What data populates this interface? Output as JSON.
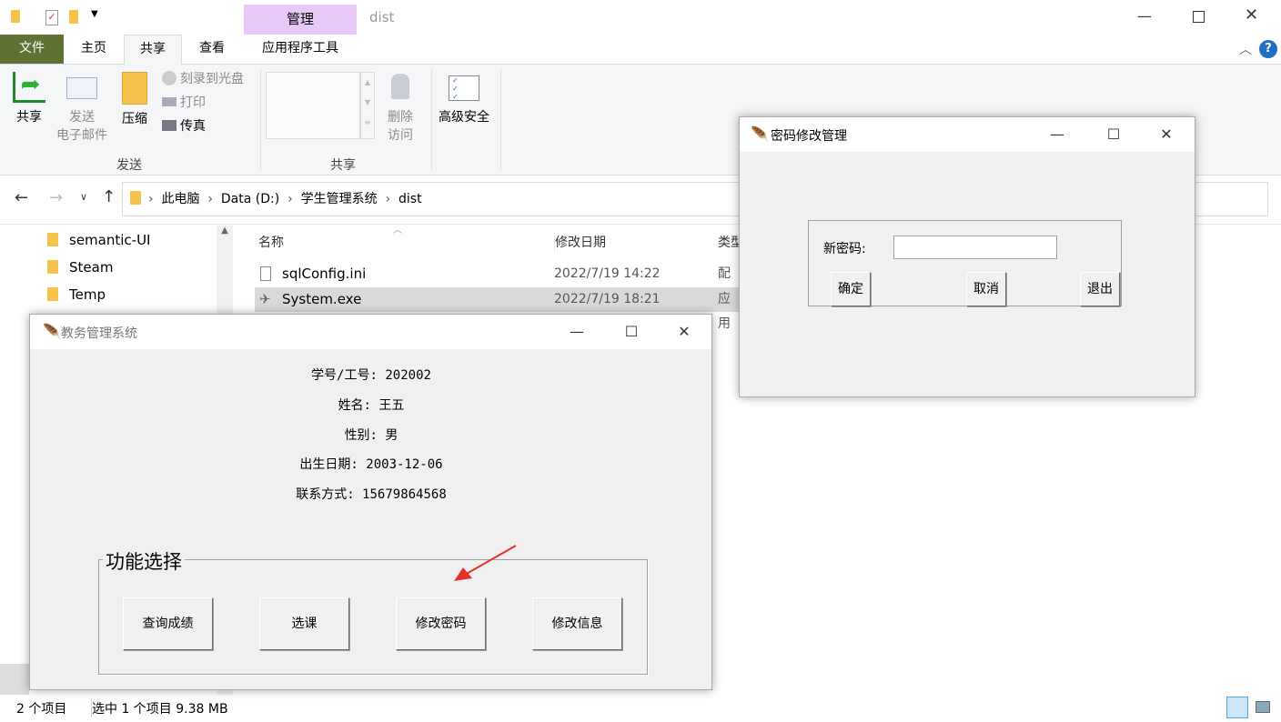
{
  "explorer": {
    "title": "dist",
    "context_tab": "管理",
    "tabs": [
      "文件",
      "主页",
      "共享",
      "查看",
      "应用程序工具"
    ],
    "ribbon": {
      "share": "共享",
      "email_line1": "发送",
      "email_line2": "电子邮件",
      "zip": "压缩",
      "burn": "刻录到光盘",
      "print": "打印",
      "fax": "传真",
      "group_send": "发送",
      "remove_line1": "删除",
      "remove_line2": "访问",
      "group_share": "共享",
      "advanced": "高级安全"
    },
    "breadcrumb": [
      "此电脑",
      "Data (D:)",
      "学生管理系统",
      "dist"
    ],
    "tree": [
      "semantic-UI",
      "Steam",
      "Temp"
    ],
    "columns": [
      "名称",
      "修改日期",
      "类型"
    ],
    "files": [
      {
        "name": "sqlConfig.ini",
        "date": "2022/7/19 14:22",
        "type": "配置"
      },
      {
        "name": "System.exe",
        "date": "2022/7/19 18:21",
        "type": "应用"
      }
    ],
    "status": {
      "count": "2 个项目",
      "selected": "选中 1 个项目  9.38 MB"
    }
  },
  "main_window": {
    "title": "教务管理系统",
    "info": [
      "学号/工号: 202002",
      "姓名: 王五",
      "性别: 男",
      "出生日期: 2003-12-06",
      "联系方式: 15679864568"
    ],
    "group_label": "功能选择",
    "buttons": [
      "查询成绩",
      "选课",
      "修改密码",
      "修改信息"
    ]
  },
  "pwd_dialog": {
    "title": "密码修改管理",
    "label": "新密码:",
    "input_value": "",
    "buttons": [
      "确定",
      "取消",
      "退出"
    ]
  },
  "colors": {
    "file_tab": "#5f7233",
    "context_tab": "#e8c8f8",
    "arrow": "#e8302a"
  }
}
